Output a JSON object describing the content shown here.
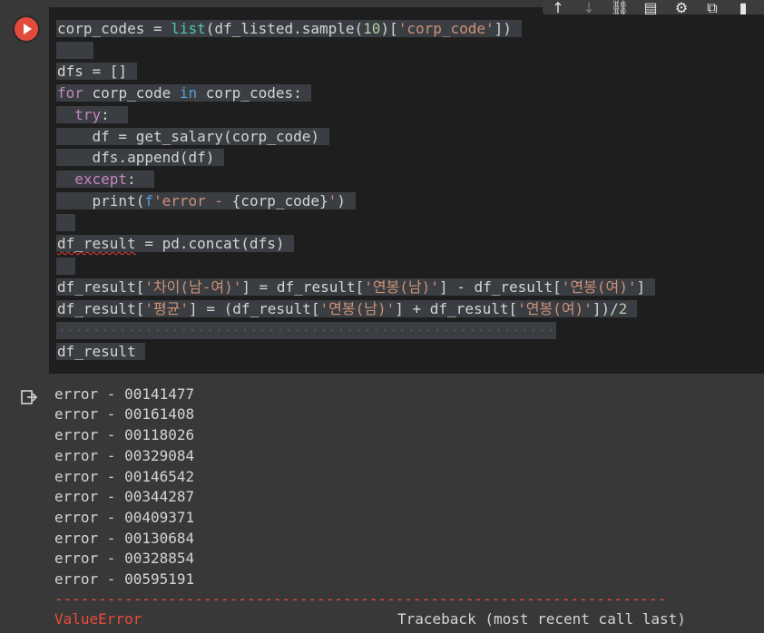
{
  "toolbar": {
    "icons": [
      "move-up-icon",
      "move-down-icon",
      "link-icon",
      "comment-icon",
      "settings-icon",
      "open-in-tab-icon",
      "delete-icon"
    ]
  },
  "code": {
    "l1_a": "corp_codes = ",
    "l1_fn": "list",
    "l1_b": "(df_listed.sample(",
    "l1_num": "10",
    "l1_c": ")[",
    "l1_str": "'corp_code'",
    "l1_d": "])",
    "l2": "dfs = []",
    "l3_kw": "for",
    "l3_a": " corp_code ",
    "l3_in": "in",
    "l3_b": " corp_codes:",
    "l4_kw": "try",
    "l4_b": ":",
    "l5": "df = get_salary(corp_code)",
    "l6": "dfs.append(df)",
    "l7_kw": "except",
    "l7_b": ":",
    "l8_a": "print(",
    "l8_f": "f",
    "l8_str": "'error - ",
    "l8_b": "{corp_code}",
    "l8_str2": "'",
    "l8_c": ")",
    "l9_var": "df_result",
    "l9_a": " = pd.concat(dfs)",
    "l10_a": "df_result[",
    "l10_str": "'차이(남-여)'",
    "l10_b": "] = df_result[",
    "l10_str2": "'연봉(남)'",
    "l10_c": "] - df_result[",
    "l10_str3": "'연봉(여)'",
    "l10_d": "]",
    "l11_a": "df_result[",
    "l11_str": "'평균'",
    "l11_b": "] = (df_result[",
    "l11_str2": "'연봉(남)'",
    "l11_c": "] + df_result[",
    "l11_str3": "'연봉(여)'",
    "l11_d": "])/",
    "l11_num": "2",
    "l12": "df_result"
  },
  "output": {
    "lines": [
      "error - 00141477",
      "error - 00161408",
      "error - 00118026",
      "error - 00329084",
      "error - 00146542",
      "error - 00344287",
      "error - 00409371",
      "error - 00130684",
      "error - 00328854",
      "error - 00595191"
    ],
    "separator": "---------------------------------------------------------------------------",
    "error_name": "ValueError",
    "traceback": "Traceback (most recent call last)"
  }
}
